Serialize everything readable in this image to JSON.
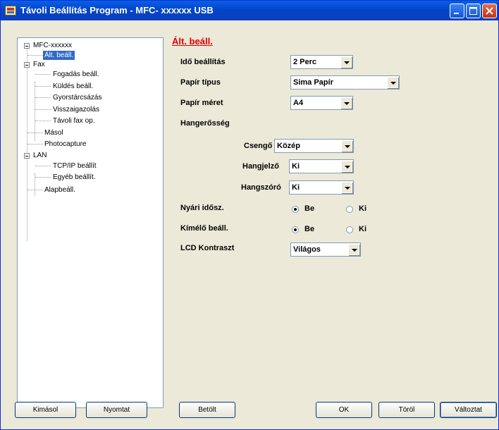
{
  "window": {
    "title": "Távoli Beállítás Program - MFC- xxxxxx USB"
  },
  "tree": {
    "root": "MFC-xxxxxx",
    "items": [
      "Ált. beáll.",
      "Fax",
      "Fogadás beáll.",
      "Küldés beáll.",
      "Gyorstárcsázás",
      "Visszaigazolás",
      "Távoli fax op.",
      "Másol",
      "Photocapture",
      "LAN",
      "TCP/IP beállít",
      "Egyéb beállít.",
      "Alapbeáll."
    ]
  },
  "panel": {
    "title": "Ált. beáll.",
    "ido_label": "Idő beállítás",
    "ido_value": "2 Perc",
    "papir_tipus_label": "Papír típus",
    "papir_tipus_value": "Sima Papír",
    "papir_meret_label": "Papír méret",
    "papir_meret_value": "A4",
    "hangero_label": "Hangerősség",
    "csengo_label": "Csengő",
    "csengo_value": "Közép",
    "hangjelzo_label": "Hangjelző",
    "hangjelzo_value": "Ki",
    "hangszoro_label": "Hangszóró",
    "hangszoro_value": "Ki",
    "nyari_label": "Nyári idősz.",
    "kimelo_label": "Kímélő beáll.",
    "be_label": "Be",
    "ki_label": "Ki",
    "nyari_selected": "Be",
    "kimelo_selected": "Be",
    "lcd_label": "LCD Kontraszt",
    "lcd_value": "Világos"
  },
  "buttons": {
    "kimasol": "Kimásol",
    "nyomtat": "Nyomtat",
    "betolt": "Betölt",
    "ok": "OK",
    "torol": "Töröl",
    "valtoztat": "Változtat"
  }
}
